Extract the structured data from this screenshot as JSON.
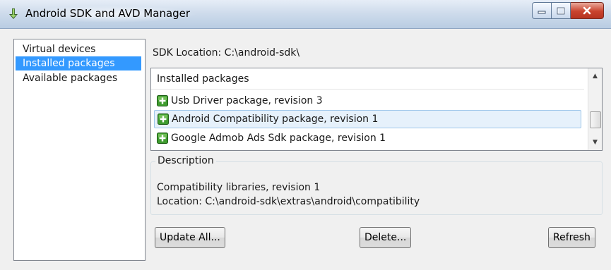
{
  "window": {
    "title": "Android SDK and AVD Manager"
  },
  "sidebar": {
    "items": [
      {
        "label": "Virtual devices",
        "selected": false
      },
      {
        "label": "Installed packages",
        "selected": true
      },
      {
        "label": "Available packages",
        "selected": false
      }
    ]
  },
  "main": {
    "sdk_location": "SDK Location: C:\\android-sdk\\",
    "list": {
      "header": "Installed packages",
      "rows": [
        {
          "label": "Usb Driver package, revision 3",
          "icon": "package-add-icon",
          "selected": false
        },
        {
          "label": "Android Compatibility package, revision 1",
          "icon": "package-add-icon",
          "selected": true
        },
        {
          "label": "Google Admob Ads Sdk package, revision 1",
          "icon": "package-add-icon",
          "selected": false
        }
      ]
    },
    "description": {
      "title": "Description",
      "line1": "Compatibility libraries, revision 1",
      "line2": "Location: C:\\android-sdk\\extras\\android\\compatibility"
    },
    "buttons": {
      "update_all": "Update All...",
      "delete": "Delete...",
      "refresh": "Refresh"
    }
  },
  "colors": {
    "selection": "#3399ff",
    "row_selected": "#e6f1fb",
    "close_button": "#c9432e",
    "package_icon": "#3f9c2f"
  }
}
